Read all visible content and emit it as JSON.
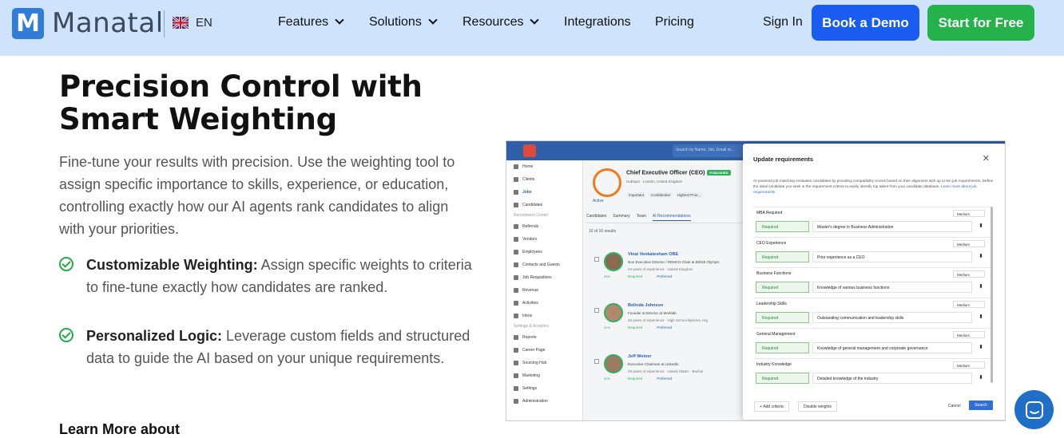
{
  "header": {
    "logo_letter": "M",
    "brand": "Manatal",
    "language": "EN",
    "nav": [
      {
        "label": "Features",
        "dropdown": true
      },
      {
        "label": "Solutions",
        "dropdown": true
      },
      {
        "label": "Resources",
        "dropdown": true
      },
      {
        "label": "Integrations",
        "dropdown": false
      },
      {
        "label": "Pricing",
        "dropdown": false
      }
    ],
    "sign_in": "Sign In",
    "book_demo": "Book a Demo",
    "start_free": "Start for Free"
  },
  "content": {
    "title": "Precision Control with Smart Weighting",
    "intro": "Fine-tune your results with precision. Use the weighting tool to assign specific importance to skills, experience, or education, controlling exactly how our AI agents rank candidates to align with your priorities.",
    "features": [
      {
        "title": "Customizable Weighting:",
        "text": " Assign specific weights to criteria to fine-tune exactly how candidates are ranked."
      },
      {
        "title": "Personalized Logic:",
        "text": " Leverage custom fields and structured data to guide the AI based on your unique requirements."
      }
    ],
    "learn_more": "Learn More about"
  },
  "app": {
    "search_placeholder": "Search by Name, Job, Email or...",
    "sidebar": [
      "Home",
      "Clients",
      "Jobs",
      "Candidates",
      "Recruitment Center",
      "Referrals",
      "Vendors",
      "Employees",
      "Contacts and Guests",
      "Job Requisitions",
      "Revenue",
      "Activities",
      "Inbox",
      "Settings & Analytics",
      "Reports",
      "Career Page",
      "Sourcing Hub",
      "Marketing",
      "Settings",
      "Administration"
    ],
    "job": {
      "title": "Chief Executive Officer (CEO)",
      "status": "PUBLISHED",
      "sub": "Hubspot  ·  London, United Kingdom",
      "tags": [
        "Important",
        "Confidential",
        "Highest Prior..."
      ],
      "active": "Active"
    },
    "tabs": [
      "Candidates",
      "Summary",
      "Team",
      "AI Recommendations"
    ],
    "results": "16 of 16 results",
    "candidates": [
      {
        "name": "Vinai Venkatesham OBE",
        "title": "Non Executive Director / REMCO Chair at British Olympic",
        "exp": "24 years of experience  ·  United Kingdom",
        "score": "93%"
      },
      {
        "name": "Belinda Johnson",
        "title": "Founder & Director at Worklab",
        "exp": "26 years of experience  ·  High School diploma, Hig",
        "score": "91%"
      },
      {
        "name": "Jeff Weiner",
        "title": "Executive Chairman at LinkedIn",
        "exp": "29 years of experience  ·  United States  ·  Bachel",
        "score": "90%"
      }
    ],
    "required_label": "Required",
    "preferred_label": "Preferred",
    "modal": {
      "title": "Update requirements",
      "desc": "AI-powered job matching evaluates candidates by providing compatibility scores based on their alignment with up to ten job requirements. Define the ideal candidate you seek in the requirement criteria to easily identify top talent from your candidate database.",
      "desc_link": "Learn more about job requirements",
      "criteria": [
        {
          "name": "MBA Required",
          "weight": "Medium",
          "req": "Required",
          "value": "Master's degree in Business Administration"
        },
        {
          "name": "CEO Experience",
          "weight": "Medium",
          "req": "Required",
          "value": "Prior experience as a CEO"
        },
        {
          "name": "Business Functions",
          "weight": "Medium",
          "req": "Required",
          "value": "Knowledge of various business functions"
        },
        {
          "name": "Leadership Skills",
          "weight": "Medium",
          "req": "Required",
          "value": "Outstanding communication and leadership skills"
        },
        {
          "name": "General Management",
          "weight": "Medium",
          "req": "Required",
          "value": "Knowledge of general management and corporate governance"
        },
        {
          "name": "Industry Knowledge",
          "weight": "Medium",
          "req": "Required",
          "value": "Detailed knowledge of the industry"
        }
      ],
      "add_criteria": "Add criteria",
      "disable_weights": "Disable weights",
      "cancel": "Cancel",
      "search": "Search"
    }
  },
  "colors": {
    "brand": "#2f7cd9",
    "demo": "#1a5cf0",
    "free": "#26b24b",
    "header_bg": "#cfe3fc"
  }
}
